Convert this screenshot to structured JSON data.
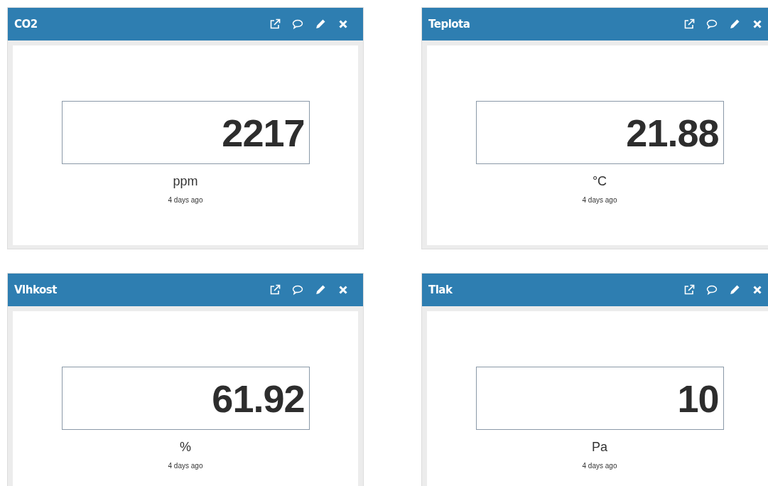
{
  "widgets": [
    {
      "title": "CO2",
      "value": "2217",
      "unit": "ppm",
      "updated": "4 days ago"
    },
    {
      "title": "Teplota",
      "value": "21.88",
      "unit": "°C",
      "updated": "4 days ago"
    },
    {
      "title": "Vlhkost",
      "value": "61.92",
      "unit": "%",
      "updated": "4 days ago"
    },
    {
      "title": "Tlak",
      "value": "10",
      "unit": "Pa",
      "updated": "4 days ago"
    }
  ]
}
